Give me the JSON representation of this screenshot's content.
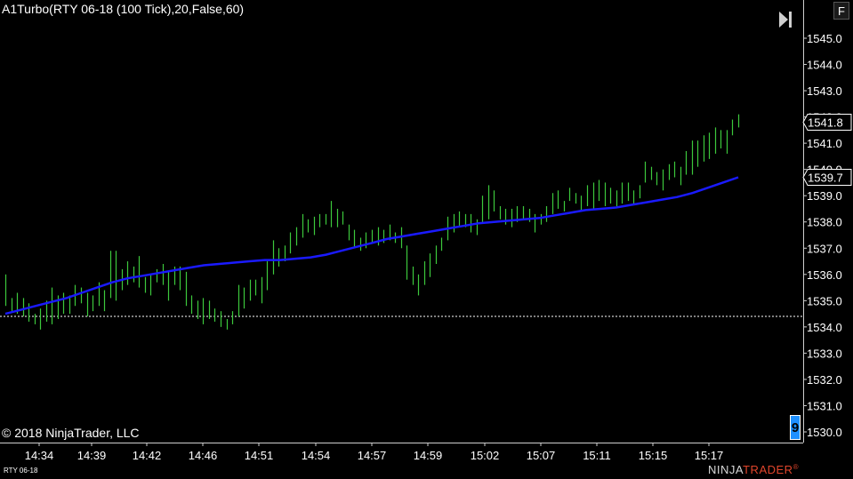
{
  "window": {
    "title": "A1Turbo(RTY 06-18 (100 Tick),20,False,60)",
    "copyright": "© 2018 NinjaTrader, LLC",
    "symbol": "RTY 06-18",
    "f_button": "F",
    "badge_value": "9",
    "logo_ninja": "NINJA",
    "logo_trader": "TRADER",
    "logo_reg": "®"
  },
  "colors": {
    "background": "#000000",
    "bar": "#3cc83c",
    "ma_line": "#1a1aff",
    "text": "#ffffff",
    "price_label_bg": "#000000",
    "dashed_line": "#ffffff"
  },
  "chart_data": {
    "type": "line",
    "title": "A1Turbo(RTY 06-18 (100 Tick),20,False,60)",
    "ylim": [
      1530.0,
      1545.5
    ],
    "y_ticks": [
      "1545.0",
      "1544.0",
      "1543.0",
      "1542.0",
      "1541.0",
      "1540.0",
      "1539.0",
      "1538.0",
      "1537.0",
      "1536.0",
      "1535.0",
      "1534.0",
      "1533.0",
      "1532.0",
      "1531.0",
      "1530.0"
    ],
    "x_tick_labels": [
      "14:34",
      "14:39",
      "14:42",
      "14:46",
      "14:51",
      "14:54",
      "14:57",
      "14:59",
      "15:02",
      "15:07",
      "15:11",
      "15:15",
      "15:17"
    ],
    "current_price_label": "1541.8",
    "ma_price_label": "1539.7",
    "reference_line_price": 1534.4,
    "bars": [
      [
        1534.8,
        1536.0
      ],
      [
        1534.6,
        1535.1
      ],
      [
        1534.5,
        1535.3
      ],
      [
        1534.4,
        1535.1
      ],
      [
        1534.2,
        1534.9
      ],
      [
        1534.1,
        1534.5
      ],
      [
        1533.9,
        1534.7
      ],
      [
        1534.2,
        1535.0
      ],
      [
        1534.1,
        1535.5
      ],
      [
        1534.3,
        1535.2
      ],
      [
        1534.5,
        1535.3
      ],
      [
        1534.5,
        1535.2
      ],
      [
        1534.8,
        1535.6
      ],
      [
        1534.9,
        1535.5
      ],
      [
        1534.4,
        1535.3
      ],
      [
        1534.6,
        1535.2
      ],
      [
        1534.8,
        1535.7
      ],
      [
        1534.6,
        1535.4
      ],
      [
        1535.1,
        1536.9
      ],
      [
        1535.0,
        1536.9
      ],
      [
        1535.4,
        1536.2
      ],
      [
        1535.6,
        1536.5
      ],
      [
        1535.7,
        1536.3
      ],
      [
        1535.5,
        1536.7
      ],
      [
        1535.3,
        1535.9
      ],
      [
        1535.2,
        1536.0
      ],
      [
        1535.7,
        1536.2
      ],
      [
        1535.6,
        1536.4
      ],
      [
        1535.0,
        1536.1
      ],
      [
        1535.6,
        1536.3
      ],
      [
        1535.4,
        1536.3
      ],
      [
        1534.8,
        1536.1
      ],
      [
        1534.5,
        1535.2
      ],
      [
        1534.3,
        1535.0
      ],
      [
        1534.1,
        1535.1
      ],
      [
        1534.3,
        1535.0
      ],
      [
        1534.2,
        1534.7
      ],
      [
        1534.0,
        1534.6
      ],
      [
        1533.9,
        1534.3
      ],
      [
        1534.1,
        1534.6
      ],
      [
        1534.4,
        1535.6
      ],
      [
        1534.7,
        1535.5
      ],
      [
        1535.0,
        1535.8
      ],
      [
        1535.2,
        1535.8
      ],
      [
        1534.9,
        1535.9
      ],
      [
        1535.4,
        1536.5
      ],
      [
        1536.0,
        1537.3
      ],
      [
        1536.3,
        1537.0
      ],
      [
        1536.5,
        1537.1
      ],
      [
        1536.8,
        1537.6
      ],
      [
        1537.1,
        1537.8
      ],
      [
        1537.4,
        1538.3
      ],
      [
        1537.6,
        1538.1
      ],
      [
        1537.5,
        1538.2
      ],
      [
        1537.8,
        1538.3
      ],
      [
        1537.9,
        1538.3
      ],
      [
        1537.8,
        1538.8
      ],
      [
        1537.8,
        1538.5
      ],
      [
        1537.9,
        1538.4
      ],
      [
        1537.3,
        1537.9
      ],
      [
        1537.0,
        1537.7
      ],
      [
        1536.9,
        1537.4
      ],
      [
        1537.0,
        1537.6
      ],
      [
        1537.2,
        1537.7
      ],
      [
        1537.1,
        1537.8
      ],
      [
        1537.2,
        1537.7
      ],
      [
        1537.3,
        1537.9
      ],
      [
        1537.2,
        1537.6
      ],
      [
        1537.0,
        1537.8
      ],
      [
        1535.8,
        1537.1
      ],
      [
        1535.6,
        1536.3
      ],
      [
        1535.2,
        1536.0
      ],
      [
        1535.6,
        1536.5
      ],
      [
        1535.9,
        1536.8
      ],
      [
        1536.4,
        1537.1
      ],
      [
        1536.9,
        1537.4
      ],
      [
        1537.3,
        1538.2
      ],
      [
        1537.6,
        1538.3
      ],
      [
        1537.8,
        1538.4
      ],
      [
        1537.8,
        1538.3
      ],
      [
        1537.6,
        1538.3
      ],
      [
        1537.5,
        1538.1
      ],
      [
        1538.0,
        1539.0
      ],
      [
        1538.1,
        1539.4
      ],
      [
        1538.4,
        1539.2
      ],
      [
        1538.1,
        1538.6
      ],
      [
        1537.9,
        1538.5
      ],
      [
        1537.8,
        1538.5
      ],
      [
        1538.0,
        1538.6
      ],
      [
        1538.1,
        1538.6
      ],
      [
        1538.0,
        1538.5
      ],
      [
        1537.6,
        1538.3
      ],
      [
        1537.9,
        1538.3
      ],
      [
        1538.0,
        1538.6
      ],
      [
        1538.3,
        1539.1
      ],
      [
        1538.5,
        1539.2
      ],
      [
        1538.4,
        1538.8
      ],
      [
        1538.8,
        1539.3
      ],
      [
        1538.7,
        1539.1
      ],
      [
        1538.4,
        1539.0
      ],
      [
        1538.6,
        1539.4
      ],
      [
        1538.5,
        1539.5
      ],
      [
        1538.8,
        1539.6
      ],
      [
        1538.6,
        1539.5
      ],
      [
        1538.7,
        1539.3
      ],
      [
        1538.6,
        1539.2
      ],
      [
        1538.7,
        1539.5
      ],
      [
        1538.8,
        1539.5
      ],
      [
        1538.7,
        1539.2
      ],
      [
        1538.9,
        1539.4
      ],
      [
        1539.5,
        1540.3
      ],
      [
        1539.6,
        1540.1
      ],
      [
        1539.4,
        1539.9
      ],
      [
        1539.2,
        1540.0
      ],
      [
        1539.6,
        1540.2
      ],
      [
        1539.7,
        1540.3
      ],
      [
        1539.4,
        1540.1
      ],
      [
        1539.8,
        1540.7
      ],
      [
        1539.8,
        1541.1
      ],
      [
        1540.1,
        1541.1
      ],
      [
        1540.3,
        1541.3
      ],
      [
        1540.4,
        1541.4
      ],
      [
        1540.6,
        1541.6
      ],
      [
        1540.8,
        1541.5
      ],
      [
        1540.6,
        1541.5
      ],
      [
        1541.3,
        1541.9
      ],
      [
        1541.6,
        1542.1
      ]
    ],
    "ma": [
      1534.5,
      1534.65,
      1534.8,
      1534.95,
      1535.1,
      1535.3,
      1535.5,
      1535.7,
      1535.85,
      1535.95,
      1536.05,
      1536.15,
      1536.25,
      1536.35,
      1536.4,
      1536.45,
      1536.5,
      1536.55,
      1536.55,
      1536.6,
      1536.65,
      1536.75,
      1536.9,
      1537.05,
      1537.2,
      1537.35,
      1537.45,
      1537.55,
      1537.65,
      1537.75,
      1537.85,
      1537.95,
      1538.0,
      1538.05,
      1538.1,
      1538.15,
      1538.25,
      1538.35,
      1538.45,
      1538.5,
      1538.55,
      1538.65,
      1538.75,
      1538.85,
      1538.95,
      1539.1,
      1539.3,
      1539.5,
      1539.7
    ]
  }
}
